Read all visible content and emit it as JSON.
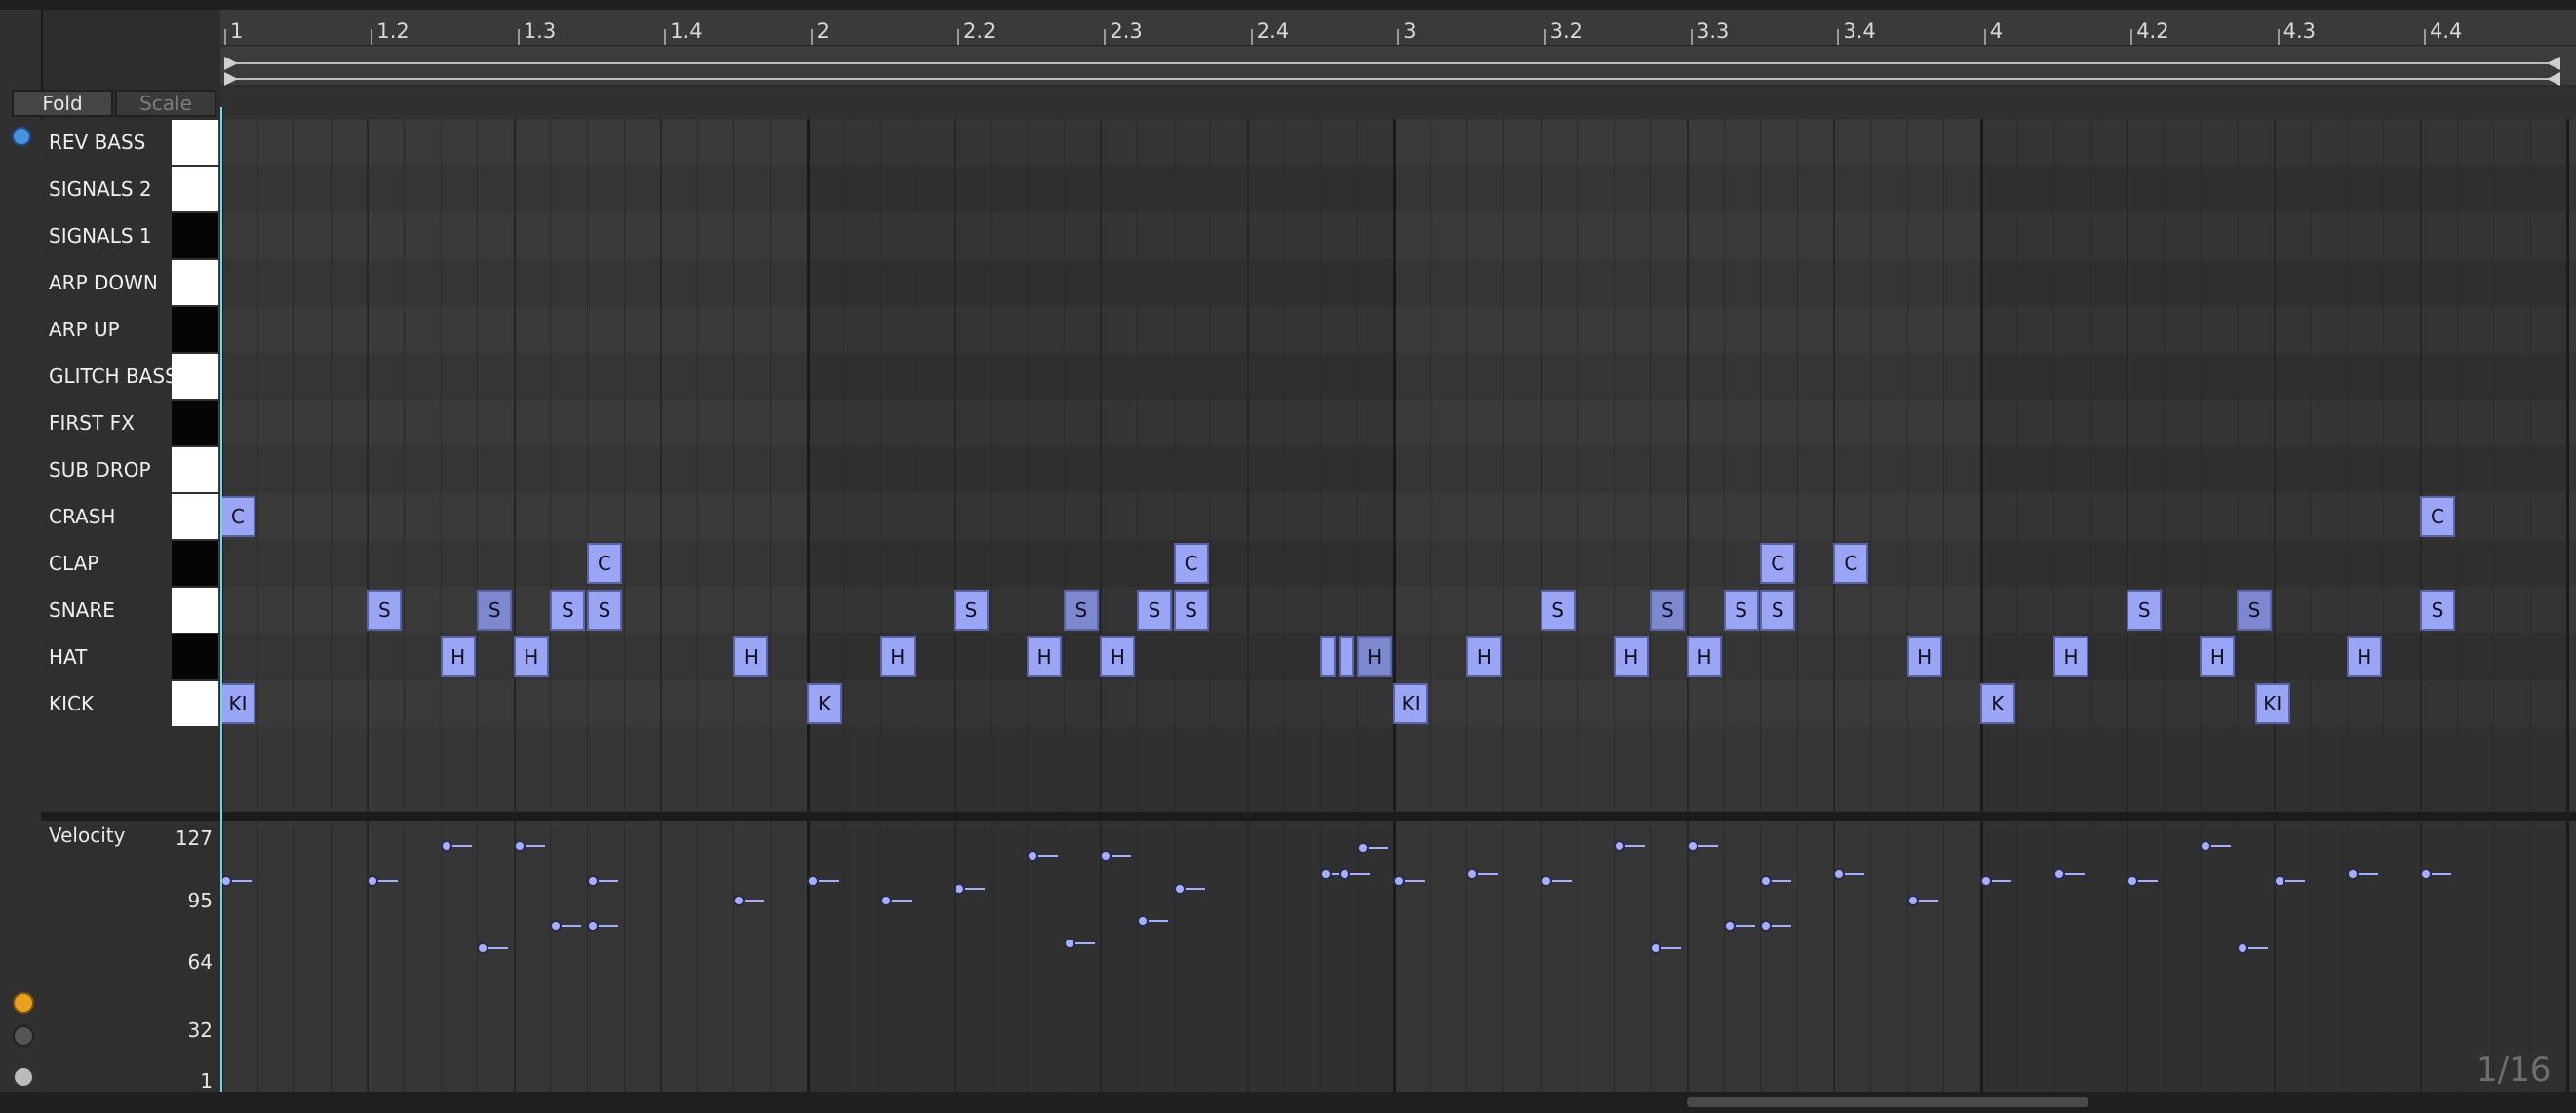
{
  "ruler": {
    "labels": [
      "1",
      "1.2",
      "1.3",
      "1.4",
      "2",
      "2.2",
      "2.3",
      "2.4",
      "3",
      "3.2",
      "3.3",
      "3.4",
      "4",
      "4.2",
      "4.3",
      "4.4"
    ]
  },
  "controls": {
    "fold": "Fold",
    "scale": "Scale"
  },
  "tracks": [
    {
      "name": "REV BASS",
      "key": "white"
    },
    {
      "name": "SIGNALS 2",
      "key": "white"
    },
    {
      "name": "SIGNALS 1",
      "key": "black"
    },
    {
      "name": "ARP DOWN",
      "key": "white"
    },
    {
      "name": "ARP UP",
      "key": "black"
    },
    {
      "name": "GLITCH BASS",
      "key": "white"
    },
    {
      "name": "FIRST FX",
      "key": "black"
    },
    {
      "name": "SUB DROP",
      "key": "white"
    },
    {
      "name": "CRASH",
      "key": "white"
    },
    {
      "name": "CLAP",
      "key": "black"
    },
    {
      "name": "SNARE",
      "key": "white"
    },
    {
      "name": "HAT",
      "key": "black"
    },
    {
      "name": "KICK",
      "key": "white"
    }
  ],
  "notes": [
    {
      "track": 8,
      "start": 1.0,
      "label": "C"
    },
    {
      "track": 8,
      "start": 16.0,
      "label": "C"
    },
    {
      "track": 9,
      "start": 3.5,
      "label": "C"
    },
    {
      "track": 9,
      "start": 7.5,
      "label": "C"
    },
    {
      "track": 9,
      "start": 11.5,
      "label": "C"
    },
    {
      "track": 9,
      "start": 12.0,
      "label": "C"
    },
    {
      "track": 10,
      "start": 2.0,
      "label": "S"
    },
    {
      "track": 10,
      "start": 2.75,
      "label": "S"
    },
    {
      "track": 10,
      "start": 3.25,
      "label": "S"
    },
    {
      "track": 10,
      "start": 3.5,
      "label": "S"
    },
    {
      "track": 10,
      "start": 6.0,
      "label": "S"
    },
    {
      "track": 10,
      "start": 6.75,
      "label": "S"
    },
    {
      "track": 10,
      "start": 7.25,
      "label": "S"
    },
    {
      "track": 10,
      "start": 7.5,
      "label": "S"
    },
    {
      "track": 10,
      "start": 10.0,
      "label": "S"
    },
    {
      "track": 10,
      "start": 10.75,
      "label": "S"
    },
    {
      "track": 10,
      "start": 11.25,
      "label": "S"
    },
    {
      "track": 10,
      "start": 11.5,
      "label": "S"
    },
    {
      "track": 10,
      "start": 14.0,
      "label": "S"
    },
    {
      "track": 10,
      "start": 14.75,
      "label": "S"
    },
    {
      "track": 10,
      "start": 16.0,
      "label": "S"
    },
    {
      "track": 11,
      "start": 2.5,
      "label": "H"
    },
    {
      "track": 11,
      "start": 3.0,
      "label": "H"
    },
    {
      "track": 11,
      "start": 4.5,
      "label": "H"
    },
    {
      "track": 11,
      "start": 5.5,
      "label": "H"
    },
    {
      "track": 11,
      "start": 6.5,
      "label": "H"
    },
    {
      "track": 11,
      "start": 7.0,
      "label": "H"
    },
    {
      "track": 11,
      "start": 8.5,
      "label": "",
      "narrow": true
    },
    {
      "track": 11,
      "start": 8.625,
      "label": "",
      "narrow": true
    },
    {
      "track": 11,
      "start": 8.75,
      "label": "H"
    },
    {
      "track": 11,
      "start": 9.5,
      "label": "H"
    },
    {
      "track": 11,
      "start": 10.5,
      "label": "H"
    },
    {
      "track": 11,
      "start": 11.0,
      "label": "H"
    },
    {
      "track": 11,
      "start": 12.5,
      "label": "H"
    },
    {
      "track": 11,
      "start": 13.5,
      "label": "H"
    },
    {
      "track": 11,
      "start": 14.5,
      "label": "H"
    },
    {
      "track": 11,
      "start": 15.5,
      "label": "H"
    },
    {
      "track": 12,
      "start": 1.0,
      "label": "KI"
    },
    {
      "track": 12,
      "start": 5.0,
      "label": "K"
    },
    {
      "track": 12,
      "start": 9.0,
      "label": "KI"
    },
    {
      "track": 12,
      "start": 13.0,
      "label": "K"
    },
    {
      "track": 12,
      "start": 14.875,
      "label": "KI"
    }
  ],
  "velocity": {
    "title": "Velocity",
    "ticks": [
      "127",
      "95",
      "64",
      "32",
      "1"
    ],
    "values": [
      {
        "start": 1.0,
        "v": 100
      },
      {
        "start": 2.0,
        "v": 100
      },
      {
        "start": 2.5,
        "v": 117
      },
      {
        "start": 2.75,
        "v": 67
      },
      {
        "start": 3.0,
        "v": 117
      },
      {
        "start": 3.25,
        "v": 78
      },
      {
        "start": 3.5,
        "v": 78
      },
      {
        "start": 3.5,
        "v": 100
      },
      {
        "start": 4.5,
        "v": 90
      },
      {
        "start": 5.0,
        "v": 100
      },
      {
        "start": 5.5,
        "v": 90
      },
      {
        "start": 6.0,
        "v": 96
      },
      {
        "start": 6.5,
        "v": 112
      },
      {
        "start": 6.75,
        "v": 69
      },
      {
        "start": 7.0,
        "v": 112
      },
      {
        "start": 7.25,
        "v": 80
      },
      {
        "start": 7.5,
        "v": 96
      },
      {
        "start": 8.5,
        "v": 103
      },
      {
        "start": 8.625,
        "v": 103
      },
      {
        "start": 8.75,
        "v": 116
      },
      {
        "start": 9.0,
        "v": 100
      },
      {
        "start": 9.5,
        "v": 103
      },
      {
        "start": 10.0,
        "v": 100
      },
      {
        "start": 10.5,
        "v": 117
      },
      {
        "start": 10.75,
        "v": 67
      },
      {
        "start": 11.0,
        "v": 117
      },
      {
        "start": 11.25,
        "v": 78
      },
      {
        "start": 11.5,
        "v": 78
      },
      {
        "start": 11.5,
        "v": 100
      },
      {
        "start": 12.0,
        "v": 103
      },
      {
        "start": 12.5,
        "v": 90
      },
      {
        "start": 13.0,
        "v": 100
      },
      {
        "start": 13.5,
        "v": 103
      },
      {
        "start": 14.0,
        "v": 100
      },
      {
        "start": 14.5,
        "v": 117
      },
      {
        "start": 14.75,
        "v": 67
      },
      {
        "start": 15.0,
        "v": 100
      },
      {
        "start": 15.5,
        "v": 103
      },
      {
        "start": 16.0,
        "v": 103
      }
    ]
  },
  "grid_resolution": "1/16"
}
